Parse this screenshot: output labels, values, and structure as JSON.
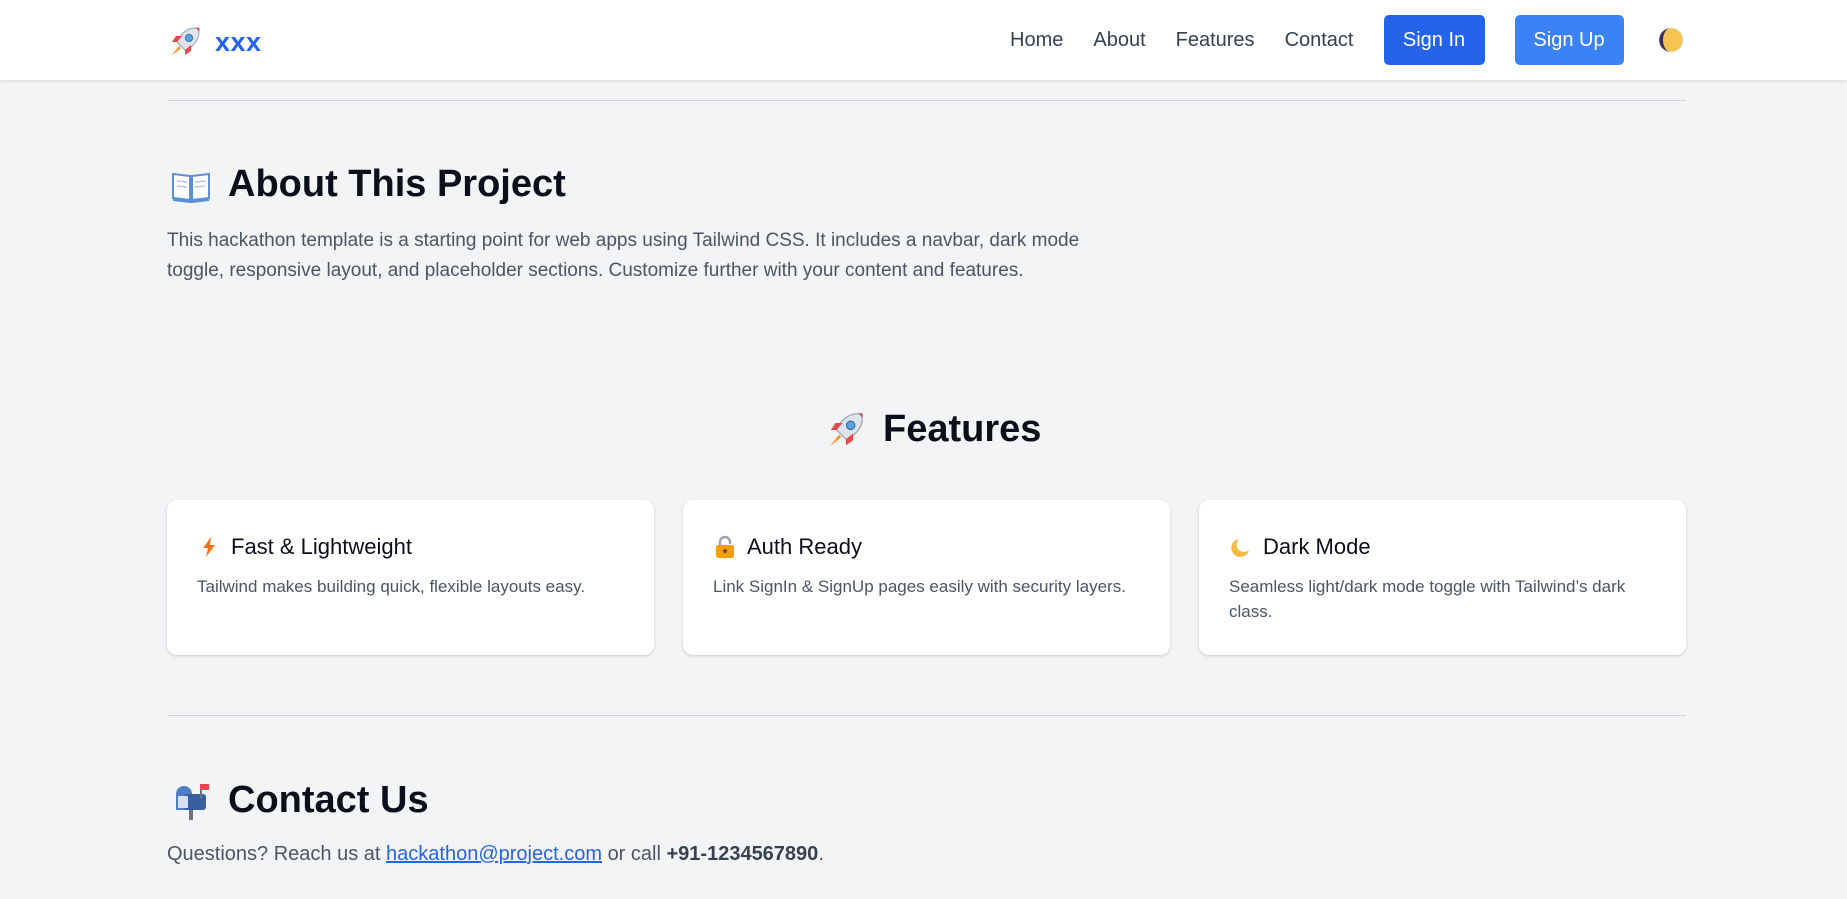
{
  "navbar": {
    "brand": "xxx",
    "links": [
      "Home",
      "About",
      "Features",
      "Contact"
    ],
    "signin_label": "Sign In",
    "signup_label": "Sign Up"
  },
  "about": {
    "heading": "About This Project",
    "text": "This hackathon template is a starting point for web apps using Tailwind CSS. It includes a navbar, dark mode toggle, responsive layout, and placeholder sections. Customize further with your content and features."
  },
  "features": {
    "heading": "Features",
    "cards": [
      {
        "icon": "lightning-icon",
        "title": "Fast & Lightweight",
        "text": "Tailwind makes building quick, flexible layouts easy."
      },
      {
        "icon": "lock-icon",
        "title": "Auth Ready",
        "text": "Link SignIn & SignUp pages easily with security layers."
      },
      {
        "icon": "moon-icon",
        "title": "Dark Mode",
        "text": "Seamless light/dark mode toggle with Tailwind’s dark class."
      }
    ]
  },
  "contact": {
    "heading": "Contact Us",
    "prefix": "Questions? Reach us at",
    "email": "hackathon@project.com",
    "middle": "or call",
    "phone": "+91-1234567890",
    "suffix": "."
  },
  "colors": {
    "accent": "#2563eb",
    "signup": "#3b82f6",
    "background": "#f3f4f6"
  }
}
